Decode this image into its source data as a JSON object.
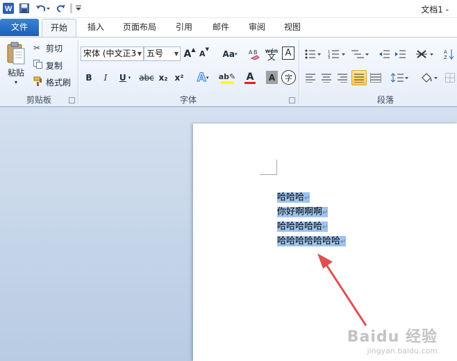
{
  "window": {
    "title": "文档1 -"
  },
  "qat": {
    "save_icon": "save-icon",
    "undo_icon": "undo-icon",
    "redo_icon": "redo-icon",
    "customize_icon": "customize-qat-icon"
  },
  "tabs": [
    {
      "label": "文件"
    },
    {
      "label": "开始"
    },
    {
      "label": "插入"
    },
    {
      "label": "页面布局"
    },
    {
      "label": "引用"
    },
    {
      "label": "邮件"
    },
    {
      "label": "审阅"
    },
    {
      "label": "视图"
    }
  ],
  "clipboard": {
    "paste_label": "粘贴",
    "cut_label": "剪切",
    "copy_label": "复制",
    "format_painter_label": "格式刷",
    "group_label": "剪贴板"
  },
  "font": {
    "font_name": "宋体 (中文正3",
    "font_size": "五号",
    "grow_label": "A",
    "shrink_label": "A",
    "change_case_label": "Aa",
    "phonetic_label": "wén",
    "bold_label": "B",
    "italic_label": "I",
    "underline_label": "U",
    "strikethrough_label": "abc",
    "subscript_label": "x₂",
    "superscript_label": "x²",
    "font_color_label": "A",
    "char_shading_label": "A",
    "enclose_label": "字",
    "group_label": "字体",
    "font_color": "#e02020",
    "highlight_color": "#ffff00"
  },
  "paragraph": {
    "group_label": "段落"
  },
  "document": {
    "lines": [
      {
        "text": "哈哈哈",
        "mark": "↵"
      },
      {
        "text": "你好啊啊啊",
        "mark": "↵"
      },
      {
        "text": "哈哈哈哈哈",
        "mark": "↵"
      },
      {
        "text": "哈哈哈哈哈哈哈",
        "mark": "↵"
      }
    ]
  },
  "watermark": {
    "brand": "Baidu 经验",
    "url": "jingyan.baidu.com"
  },
  "colors": {
    "accent": "#1b5fb8",
    "selection": "#9ec3ec",
    "arrow": "#e05050"
  }
}
